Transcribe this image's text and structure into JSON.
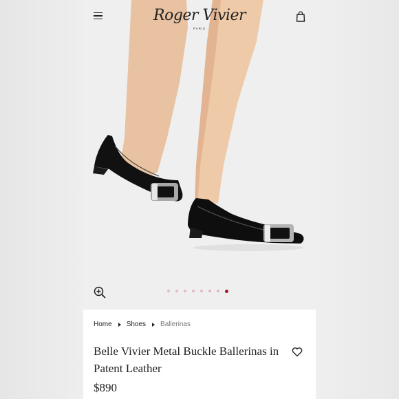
{
  "header": {
    "logo_text": "Roger Vivier",
    "logo_subtext": "PARIS"
  },
  "icons": {
    "menu": "hamburger-menu-icon",
    "bag": "shopping-bag-icon",
    "zoom": "zoom-in-icon",
    "wishlist": "heart-icon"
  },
  "gallery": {
    "dot_count": 8,
    "active_index": 7,
    "dot_color": "#e4b9c3",
    "active_dot_color": "#9c1b30"
  },
  "breadcrumb": {
    "items": [
      "Home",
      "Shoes",
      "Ballerinas"
    ]
  },
  "product": {
    "title": "Belle Vivier Metal Buckle Ballerinas in Patent Leather",
    "price": "$890"
  }
}
